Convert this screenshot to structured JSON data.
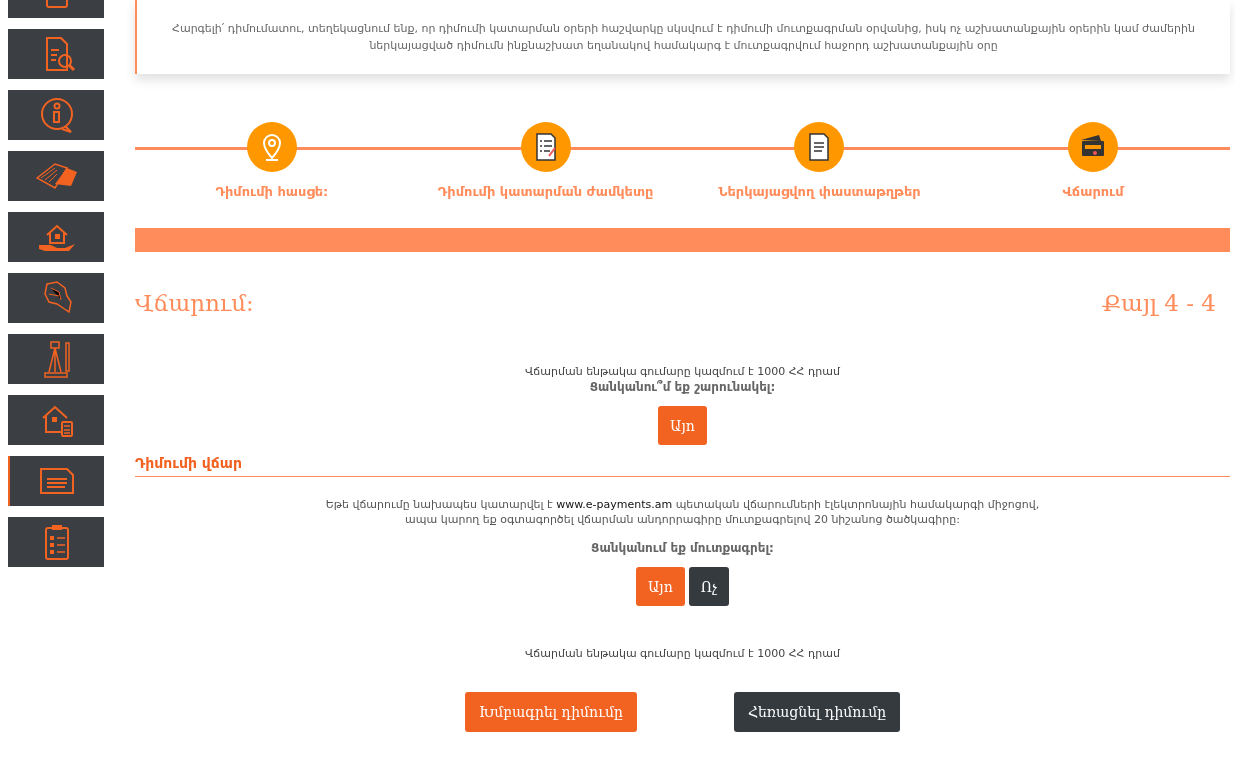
{
  "sidebar": {
    "items": [
      {
        "selected": false
      },
      {
        "selected": false
      },
      {
        "selected": false
      },
      {
        "selected": false
      },
      {
        "selected": false
      },
      {
        "selected": false
      },
      {
        "selected": false
      },
      {
        "selected": false
      },
      {
        "selected": true
      },
      {
        "selected": false
      }
    ]
  },
  "notice": {
    "lines": [
      "Հարգելի՛ դիմումատու, տեղեկացնում ենք, որ դիմումի կատարման օրերի հաշվարկը սկսվում է դիմումի մուտքագրման օրվանից, իսկ ոչ աշխատանքային օրերին կամ ժամերին",
      "ներկայացված դիմումն ինքնաշխատ եղանակով համակարգ է մուտքագրվում հաջորդ աշխատանքային օրը"
    ]
  },
  "steps": [
    {
      "label": "Դիմումի հասցե:"
    },
    {
      "label": "Դիմումի կատարման ժամկետը"
    },
    {
      "label": "Ներկայացվող փաստաթղթեր"
    },
    {
      "label": "Վճարում"
    }
  ],
  "page_title": "Վճարում:",
  "step_counter": "Քայլ 4 - 4",
  "payment": {
    "amount_text": "Վճարման ենթակա գումարը կազմում է 1000 ՀՀ դրամ",
    "question": "Ցանկանու՞մ եք շարունակել:",
    "buttons": [
      {
        "label": "Այո",
        "kind": "primary"
      }
    ]
  },
  "fee_section": {
    "title": "Դիմումի վճար",
    "before": "Եթե վճարումը նախապես կատարվել է",
    "link": "www.e-payments.am",
    "after": "պետական վճարումների էլեկտրոնային համակարգի միջոցով,",
    "second_line": "ապա կարող եք օգտագործել վճարման անդորրագիրը մուտքագրելով 20 նիշանոց ծածկագիրը:",
    "question": "Ցանկանում եք մուտքագրել:",
    "buttons": [
      {
        "label": "Այո",
        "kind": "primary"
      },
      {
        "label": "Ոչ",
        "kind": "dark"
      }
    ],
    "amount_text": "Վճարման ենթակա գումարը կազմում է 1000 ՀՀ դրամ"
  },
  "footer_buttons": [
    {
      "label": "Խմբագրել դիմումը",
      "kind": "primary"
    },
    {
      "label": "Հեռացնել դիմումը",
      "kind": "dark"
    }
  ]
}
